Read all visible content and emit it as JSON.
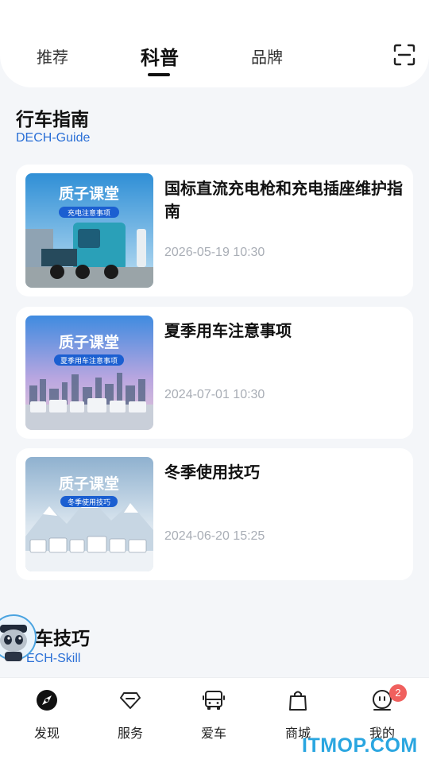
{
  "tabs": [
    {
      "label": "推荐"
    },
    {
      "label": "科普"
    },
    {
      "label": "品牌"
    }
  ],
  "section": {
    "title": "行车指南",
    "subtitle": "DECH-Guide"
  },
  "articles": [
    {
      "title": "国标直流充电枪和充电插座维护指南",
      "date": "2026-05-19 10:30",
      "banner": "质子课堂",
      "banner_sub": "充电注意事项",
      "theme": "#3a8fcf"
    },
    {
      "title": "夏季用车注意事项",
      "date": "2024-07-01 10:30",
      "banner": "质子课堂",
      "banner_sub": "夏季用车注意事项",
      "theme": "#5a8fd8"
    },
    {
      "title": "冬季使用技巧",
      "date": "2024-06-20 15:25",
      "banner": "质子课堂",
      "banner_sub": "冬季使用技巧",
      "theme": "#9fb9d3"
    }
  ],
  "section2": {
    "title": "车技巧",
    "subtitle": "ECH-Skill"
  },
  "nav": [
    {
      "label": "发现",
      "icon": "compass-icon"
    },
    {
      "label": "服务",
      "icon": "diamond-icon"
    },
    {
      "label": "爱车",
      "icon": "bus-icon"
    },
    {
      "label": "商城",
      "icon": "shopping-bag-icon"
    },
    {
      "label": "我的",
      "icon": "face-icon",
      "badge": "2"
    }
  ],
  "watermark": "ITMOP.COM"
}
